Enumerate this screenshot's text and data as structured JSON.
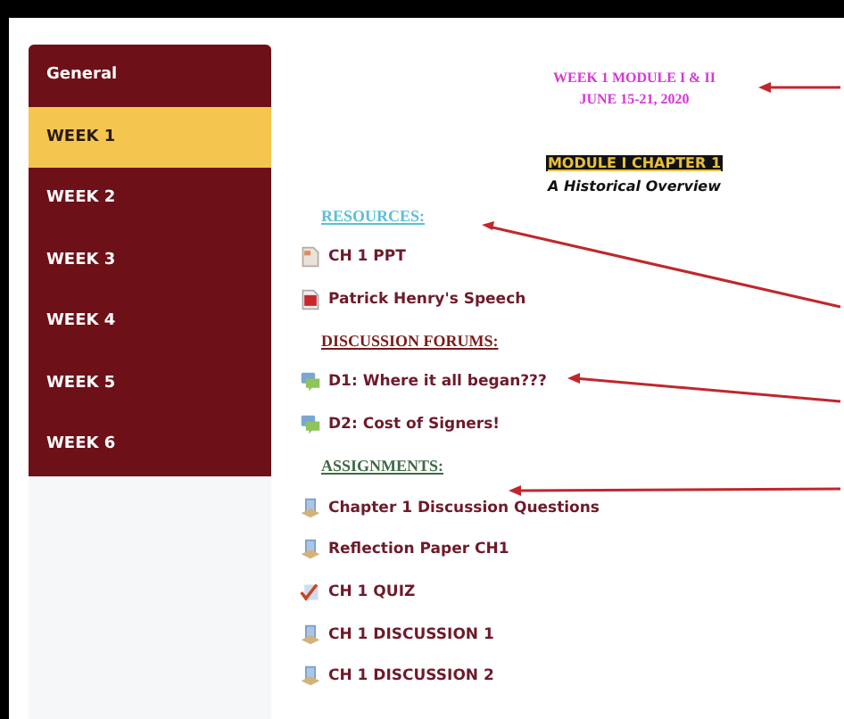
{
  "sidebar": {
    "items": [
      {
        "label": "General",
        "selected": false
      },
      {
        "label": "WEEK 1",
        "selected": true
      },
      {
        "label": "WEEK 2",
        "selected": false
      },
      {
        "label": "WEEK 3",
        "selected": false
      },
      {
        "label": "WEEK 4",
        "selected": false
      },
      {
        "label": "WEEK 5",
        "selected": false
      },
      {
        "label": "WEEK 6",
        "selected": false
      }
    ]
  },
  "content": {
    "header_lines": [
      "WEEK 1 MODULE I & II",
      "JUNE 15-21, 2020"
    ],
    "module_title": "MODULE I  CHAPTER 1",
    "subtitle": "A Historical Overview",
    "sections": [
      {
        "heading": "RESOURCES:",
        "color": "#5bc0d6",
        "items": [
          {
            "kind": "file",
            "label": "CH 1 PPT"
          },
          {
            "kind": "pdf",
            "label": "Patrick Henry's Speech"
          }
        ]
      },
      {
        "heading": "DISCUSSION FORUMS:",
        "color": "#7a1a1a",
        "items": [
          {
            "kind": "forum",
            "label": "D1: Where it all began???"
          },
          {
            "kind": "forum",
            "label": "D2: Cost of Signers!"
          }
        ]
      },
      {
        "heading": "ASSIGNMENTS:",
        "color": "#3f6a45",
        "items": [
          {
            "kind": "assignment",
            "label": "Chapter 1 Discussion Questions"
          },
          {
            "kind": "assignment",
            "label": "Reflection Paper CH1"
          },
          {
            "kind": "quiz",
            "label": "CH 1 QUIZ"
          },
          {
            "kind": "assignment",
            "label": "CH 1 DISCUSSION 1"
          },
          {
            "kind": "assignment",
            "label": "CH 1 DISCUSSION 2"
          }
        ]
      }
    ]
  }
}
